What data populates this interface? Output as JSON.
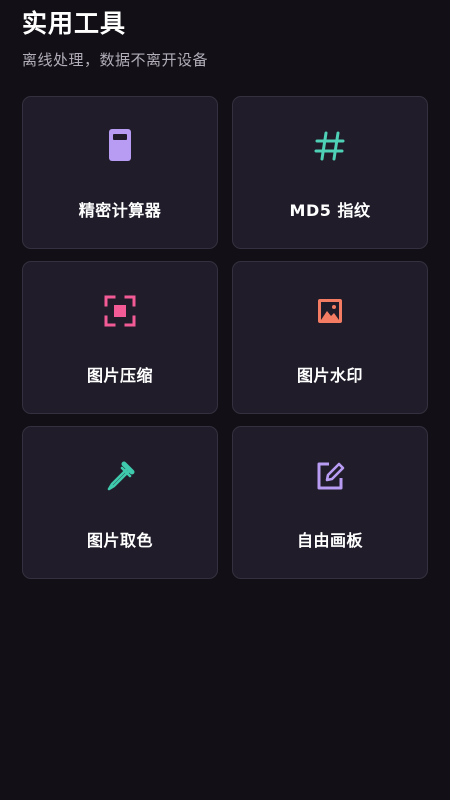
{
  "header": {
    "title": "实用工具",
    "subtitle": "离线处理，数据不离开设备"
  },
  "tools": [
    {
      "label": "精密计算器",
      "icon": "calculator-icon",
      "color": "#b89cf4"
    },
    {
      "label": "MD5 指纹",
      "icon": "hash-icon",
      "color": "#4fd1b8"
    },
    {
      "label": "图片压缩",
      "icon": "compress-icon",
      "color": "#f25b95"
    },
    {
      "label": "图片水印",
      "icon": "image-icon",
      "color": "#f47c63"
    },
    {
      "label": "图片取色",
      "icon": "eyedropper-icon",
      "color": "#3fc9ad"
    },
    {
      "label": "自由画板",
      "icon": "edit-icon",
      "color": "#b89cf4"
    }
  ]
}
